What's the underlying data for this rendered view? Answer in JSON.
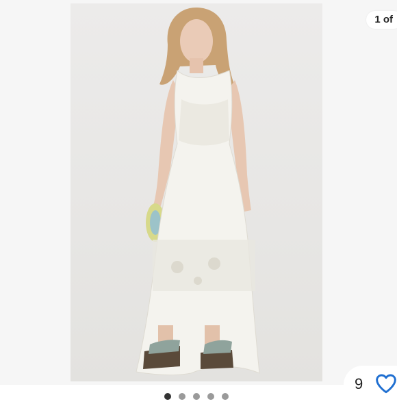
{
  "listing": {
    "image_counter": "1 of",
    "like_count": "9",
    "carousel": {
      "total_visible_dots": 5,
      "active_index": 0
    }
  },
  "icons": {
    "like": "heart-icon"
  },
  "colors": {
    "accent": "#1f6fd1",
    "dot_active": "#333333",
    "dot_inactive": "#9a9a9a"
  }
}
